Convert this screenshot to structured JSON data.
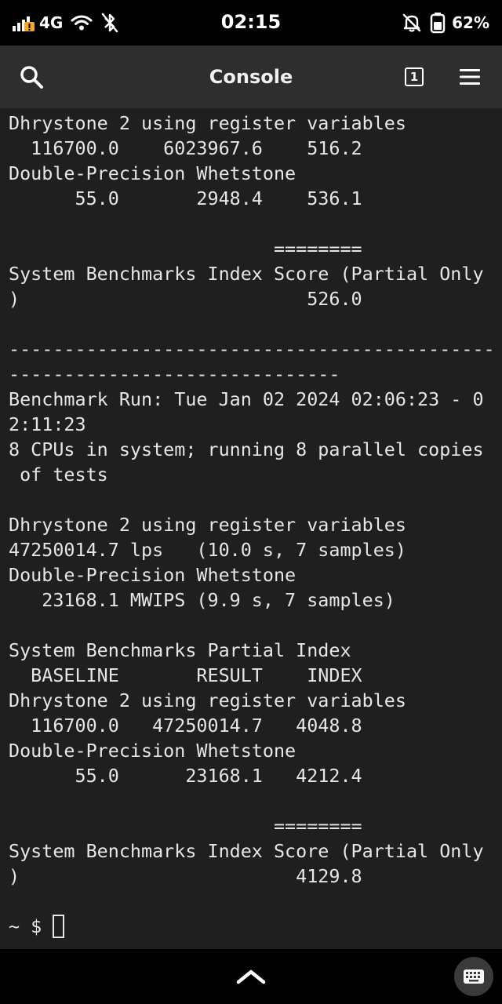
{
  "status_bar": {
    "network": "4G",
    "time": "02:15",
    "battery": "62%",
    "icons": [
      "signal-icon",
      "wifi-icon",
      "bluetooth-off-icon",
      "bell-off-icon",
      "battery-icon"
    ],
    "signal_accent": "#f5a623"
  },
  "app_bar": {
    "title": "Console",
    "session_count": "1",
    "icons": [
      "search-icon",
      "session-icon",
      "hamburger-menu-icon"
    ]
  },
  "terminal": {
    "lines": [
      "Dhrystone 2 using register variables",
      "  116700.0    6023967.6    516.2",
      "Double-Precision Whetstone",
      "      55.0       2948.4    536.1",
      "",
      "                        ========",
      "System Benchmarks Index Score (Partial Only",
      ")                          526.0",
      "",
      "--------------------------------------------",
      "------------------------------",
      "Benchmark Run: Tue Jan 02 2024 02:06:23 - 0",
      "2:11:23",
      "8 CPUs in system; running 8 parallel copies",
      " of tests",
      "",
      "Dhrystone 2 using register variables",
      "47250014.7 lps   (10.0 s, 7 samples)",
      "Double-Precision Whetstone",
      "   23168.1 MWIPS (9.9 s, 7 samples)",
      "",
      "System Benchmarks Partial Index",
      "  BASELINE       RESULT    INDEX",
      "Dhrystone 2 using register variables",
      "  116700.0   47250014.7   4048.8",
      "Double-Precision Whetstone",
      "      55.0      23168.1   4212.4",
      "",
      "                        ========",
      "System Benchmarks Index Score (Partial Only",
      ")                         4129.8",
      ""
    ],
    "prompt": "~ $"
  },
  "bottom_bar": {
    "icons": [
      "chevron-up-icon",
      "keyboard-icon"
    ]
  }
}
